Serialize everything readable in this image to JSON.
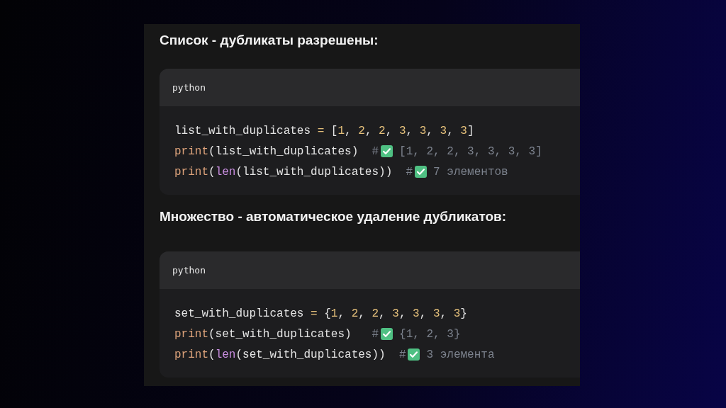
{
  "sections": [
    {
      "heading": "Список - дубликаты разрешены:",
      "language": "python",
      "lines": [
        {
          "code": [
            {
              "kind": "name",
              "text": "list_with_duplicates "
            },
            {
              "kind": "op",
              "text": "="
            },
            {
              "kind": "punct",
              "text": " ["
            },
            {
              "kind": "num",
              "text": "1"
            },
            {
              "kind": "punct",
              "text": ", "
            },
            {
              "kind": "num",
              "text": "2"
            },
            {
              "kind": "punct",
              "text": ", "
            },
            {
              "kind": "num",
              "text": "2"
            },
            {
              "kind": "punct",
              "text": ", "
            },
            {
              "kind": "num",
              "text": "3"
            },
            {
              "kind": "punct",
              "text": ", "
            },
            {
              "kind": "num",
              "text": "3"
            },
            {
              "kind": "punct",
              "text": ", "
            },
            {
              "kind": "num",
              "text": "3"
            },
            {
              "kind": "punct",
              "text": ", "
            },
            {
              "kind": "num",
              "text": "3"
            },
            {
              "kind": "punct",
              "text": "]"
            }
          ]
        },
        {
          "code": [
            {
              "kind": "func",
              "text": "print"
            },
            {
              "kind": "punct",
              "text": "(list_with_duplicates)  "
            },
            {
              "kind": "comment",
              "text": "#"
            }
          ],
          "check": true,
          "comment": "[1, 2, 2, 3, 3, 3, 3]"
        },
        {
          "code": [
            {
              "kind": "func",
              "text": "print"
            },
            {
              "kind": "punct",
              "text": "("
            },
            {
              "kind": "builtin",
              "text": "len"
            },
            {
              "kind": "punct",
              "text": "(list_with_duplicates))  "
            },
            {
              "kind": "comment",
              "text": "#"
            }
          ],
          "check": true,
          "comment": "7 элементов"
        }
      ]
    },
    {
      "heading": "Множество - автоматическое удаление дубликатов:",
      "language": "python",
      "lines": [
        {
          "code": [
            {
              "kind": "name",
              "text": "set_with_duplicates "
            },
            {
              "kind": "op",
              "text": "="
            },
            {
              "kind": "punct",
              "text": " {"
            },
            {
              "kind": "num",
              "text": "1"
            },
            {
              "kind": "punct",
              "text": ", "
            },
            {
              "kind": "num",
              "text": "2"
            },
            {
              "kind": "punct",
              "text": ", "
            },
            {
              "kind": "num",
              "text": "2"
            },
            {
              "kind": "punct",
              "text": ", "
            },
            {
              "kind": "num",
              "text": "3"
            },
            {
              "kind": "punct",
              "text": ", "
            },
            {
              "kind": "num",
              "text": "3"
            },
            {
              "kind": "punct",
              "text": ", "
            },
            {
              "kind": "num",
              "text": "3"
            },
            {
              "kind": "punct",
              "text": ", "
            },
            {
              "kind": "num",
              "text": "3"
            },
            {
              "kind": "punct",
              "text": "}"
            }
          ]
        },
        {
          "code": [
            {
              "kind": "func",
              "text": "print"
            },
            {
              "kind": "punct",
              "text": "(set_with_duplicates)   "
            },
            {
              "kind": "comment",
              "text": "#"
            }
          ],
          "check": true,
          "comment": "{1, 2, 3}"
        },
        {
          "code": [
            {
              "kind": "func",
              "text": "print"
            },
            {
              "kind": "punct",
              "text": "("
            },
            {
              "kind": "builtin",
              "text": "len"
            },
            {
              "kind": "punct",
              "text": "(set_with_duplicates))  "
            },
            {
              "kind": "comment",
              "text": "#"
            }
          ],
          "check": true,
          "comment": "3 элемента"
        }
      ]
    }
  ]
}
